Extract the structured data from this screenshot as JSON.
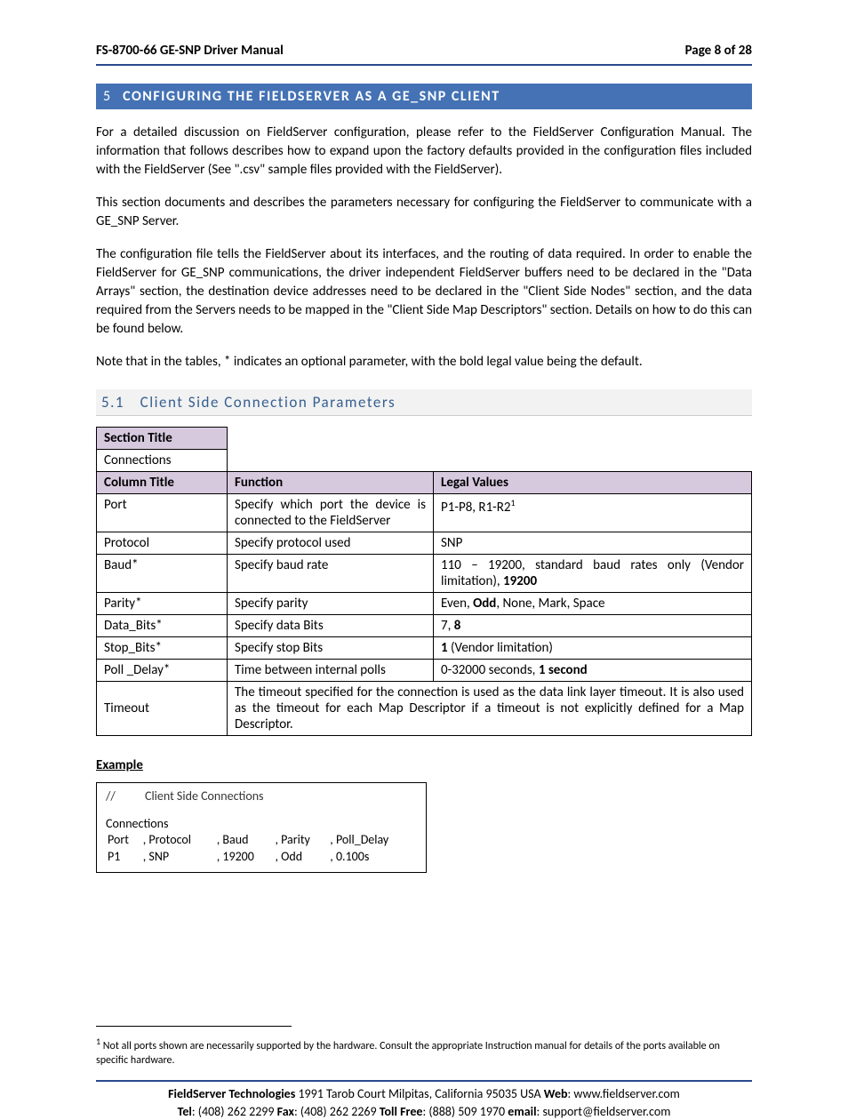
{
  "header": {
    "left": "FS-8700-66 GE-SNP Driver Manual",
    "right": "Page 8 of 28"
  },
  "section": {
    "num": "5",
    "title": "CONFIGURING THE FIELDSERVER AS A GE_SNP CLIENT"
  },
  "para1": "For a detailed discussion on FieldServer configuration, please refer to the FieldServer Configuration Manual.  The information that follows describes how to expand upon the factory defaults provided in the configuration files included with the FieldServer (See \".csv\" sample files provided with the FieldServer).",
  "para2": "This section documents and describes the parameters necessary for configuring the FieldServer to communicate with a GE_SNP Server.",
  "para3": "The configuration file tells the FieldServer about its interfaces, and the routing of data required.  In order to enable the FieldServer for GE_SNP communications, the driver independent FieldServer buffers need to be declared in the \"Data Arrays\" section, the destination device addresses need to be declared in the \"Client Side Nodes\" section, and the data required from the Servers needs to be mapped in the \"Client Side Map Descriptors\" section.  Details on how to do this can be found below.",
  "para4": "Note that in the tables, * indicates an optional parameter, with the bold legal value being the default.",
  "subsection": {
    "num": "5.1",
    "title": "Client Side Connection Parameters"
  },
  "table": {
    "sectionTitleLabel": "Section Title",
    "sectionTitleValue": "Connections",
    "headers": {
      "col": "Column Title",
      "func": "Function",
      "legal": "Legal Values"
    },
    "rows": [
      {
        "c": "Port",
        "f": "Specify which port the device is connected to the FieldServer",
        "l_pre": "P1-P8, R1-R2",
        "l_sup": "1",
        "l_post": ""
      },
      {
        "c": "Protocol",
        "f": "Specify protocol used",
        "l_pre": "SNP",
        "l_bold": "",
        "l_post": ""
      },
      {
        "c": "Baud*",
        "f": "Specify baud rate",
        "l_pre": "110 – 19200, standard baud rates only (Vendor limitation), ",
        "l_bold": "19200",
        "l_post": ""
      },
      {
        "c": "Parity*",
        "f": "Specify parity",
        "l_pre": "Even, ",
        "l_bold": "Odd",
        "l_post": ", None, Mark, Space"
      },
      {
        "c": "Data_Bits*",
        "f": "Specify data Bits",
        "l_pre": "7, ",
        "l_bold": "8",
        "l_post": ""
      },
      {
        "c": "Stop_Bits*",
        "f": "Specify stop Bits",
        "l_pre": "",
        "l_bold": "1",
        "l_post": " (Vendor limitation)"
      },
      {
        "c": "Poll _Delay*",
        "f": "Time between internal polls",
        "l_pre": "0-32000 seconds, ",
        "l_bold": "1 second",
        "l_post": ""
      }
    ],
    "timeoutLabel": "Timeout",
    "timeoutText": "The timeout specified for the connection is used as the data link layer timeout. It is also used as the timeout for each Map Descriptor if a timeout is not explicitly defined for a Map Descriptor."
  },
  "exampleLabel": "Example",
  "example": {
    "commentSlash": "//",
    "commentText": "Client Side Connections",
    "sectionWord": "Connections",
    "headerRow": [
      "Port",
      ", Protocol",
      ", Baud",
      ", Parity",
      ", Poll_Delay"
    ],
    "dataRow": [
      "P1",
      ", SNP",
      ", 19200",
      ", Odd",
      ", 0.100s"
    ]
  },
  "footnote": {
    "mark": "1",
    "text": " Not all ports shown are necessarily supported by the hardware. Consult the appropriate Instruction manual for details of the ports available on specific hardware."
  },
  "footer": {
    "l1_b1": "FieldServer Technologies",
    "l1_t1": " 1991 Tarob Court Milpitas, California 95035 USA   ",
    "l1_b2": "Web",
    "l1_t2": ": www.fieldserver.com",
    "l2_b1": "Tel",
    "l2_t1": ": (408) 262 2299   ",
    "l2_b2": "Fax",
    "l2_t2": ": (408) 262 2269   ",
    "l2_b3": "Toll Free",
    "l2_t3": ": (888) 509 1970   ",
    "l2_b4": "email",
    "l2_t4": ": support@fieldserver.com"
  }
}
